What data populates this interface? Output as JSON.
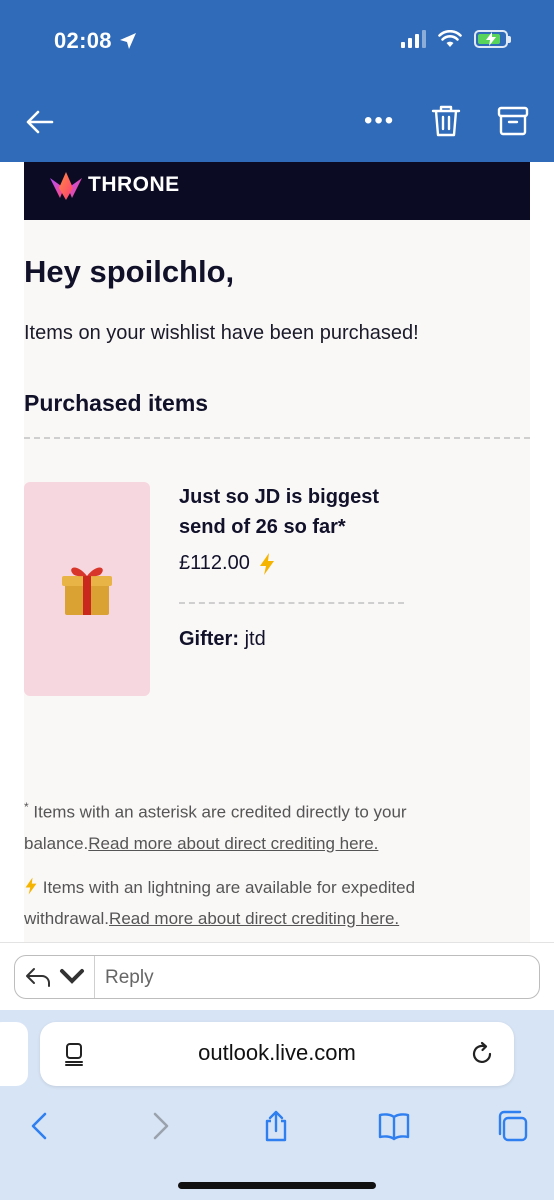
{
  "status_bar": {
    "time": "02:08",
    "battery_color": "#59d45b"
  },
  "colors": {
    "header_blue": "#2f6bb8",
    "brand_dark": "#0c0b24",
    "thumb_pink": "#f7d7df",
    "lightning": "#f5b400"
  },
  "toolbar": {
    "more_label": "•••"
  },
  "email": {
    "brand_name": "THRONE",
    "greeting": "Hey spoilchlo,",
    "intro": "Items on your wishlist have been purchased!",
    "section_title": "Purchased items",
    "item": {
      "title": "Just so JD is biggest send of 26 so far*",
      "price": "£112.00",
      "gifter_label": "Gifter:",
      "gifter_name": "jtd"
    },
    "footnotes": {
      "asterisk_mark": "*",
      "asterisk_text": " Items with an asterisk are credited directly to your balance.",
      "asterisk_link": "Read more about direct crediting here.",
      "lightning_text": " Items with an lightning are available for expedited withdrawal.",
      "lightning_link": "Read more about direct crediting here."
    }
  },
  "reply": {
    "placeholder": "Reply"
  },
  "browser": {
    "url": "outlook.live.com"
  }
}
